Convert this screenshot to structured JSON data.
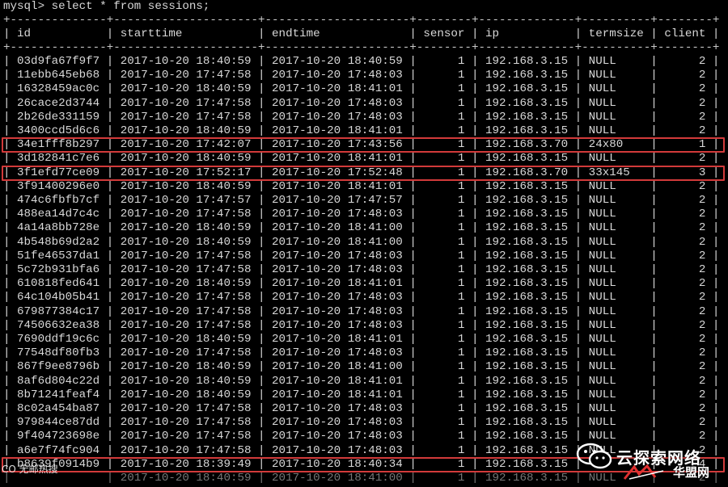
{
  "terminal": {
    "prompt": "mysql> ",
    "command": "select * from sessions;"
  },
  "table": {
    "border": "+--------------+---------------------+---------------------+--------+--------------+----------+--------+",
    "columns": [
      "id",
      "starttime",
      "endtime",
      "sensor",
      "ip",
      "termsize",
      "client"
    ],
    "rows": [
      [
        "03d9fa67f9f7",
        "2017-10-20 18:40:59",
        "2017-10-20 18:40:59",
        "1",
        "192.168.3.15",
        "NULL",
        "2"
      ],
      [
        "11ebb645eb68",
        "2017-10-20 17:47:58",
        "2017-10-20 17:48:03",
        "1",
        "192.168.3.15",
        "NULL",
        "2"
      ],
      [
        "16328459ac0c",
        "2017-10-20 18:40:59",
        "2017-10-20 18:41:01",
        "1",
        "192.168.3.15",
        "NULL",
        "2"
      ],
      [
        "26cace2d3744",
        "2017-10-20 17:47:58",
        "2017-10-20 17:48:03",
        "1",
        "192.168.3.15",
        "NULL",
        "2"
      ],
      [
        "2b26de331159",
        "2017-10-20 17:47:58",
        "2017-10-20 17:48:03",
        "1",
        "192.168.3.15",
        "NULL",
        "2"
      ],
      [
        "3400ccd5d6c6",
        "2017-10-20 18:40:59",
        "2017-10-20 18:41:01",
        "1",
        "192.168.3.15",
        "NULL",
        "2"
      ],
      [
        "34e1fff8b297",
        "2017-10-20 17:42:07",
        "2017-10-20 17:43:56",
        "1",
        "192.168.3.70",
        "24x80",
        "1"
      ],
      [
        "3d182841c7e6",
        "2017-10-20 18:40:59",
        "2017-10-20 18:41:01",
        "1",
        "192.168.3.15",
        "NULL",
        "2"
      ],
      [
        "3f1efd77ce09",
        "2017-10-20 17:52:17",
        "2017-10-20 17:52:48",
        "1",
        "192.168.3.70",
        "33x145",
        "3"
      ],
      [
        "3f91400296e0",
        "2017-10-20 18:40:59",
        "2017-10-20 18:41:01",
        "1",
        "192.168.3.15",
        "NULL",
        "2"
      ],
      [
        "474c6fbfb7cf",
        "2017-10-20 17:47:57",
        "2017-10-20 17:47:57",
        "1",
        "192.168.3.15",
        "NULL",
        "2"
      ],
      [
        "488ea14d7c4c",
        "2017-10-20 17:47:58",
        "2017-10-20 17:48:03",
        "1",
        "192.168.3.15",
        "NULL",
        "2"
      ],
      [
        "4a14a8bb728e",
        "2017-10-20 18:40:59",
        "2017-10-20 18:41:00",
        "1",
        "192.168.3.15",
        "NULL",
        "2"
      ],
      [
        "4b548b69d2a2",
        "2017-10-20 18:40:59",
        "2017-10-20 18:41:00",
        "1",
        "192.168.3.15",
        "NULL",
        "2"
      ],
      [
        "51fe46537da1",
        "2017-10-20 17:47:58",
        "2017-10-20 17:48:03",
        "1",
        "192.168.3.15",
        "NULL",
        "2"
      ],
      [
        "5c72b931bfa6",
        "2017-10-20 17:47:58",
        "2017-10-20 17:48:03",
        "1",
        "192.168.3.15",
        "NULL",
        "2"
      ],
      [
        "610818fed641",
        "2017-10-20 18:40:59",
        "2017-10-20 18:41:01",
        "1",
        "192.168.3.15",
        "NULL",
        "2"
      ],
      [
        "64c104b05b41",
        "2017-10-20 17:47:58",
        "2017-10-20 17:48:03",
        "1",
        "192.168.3.15",
        "NULL",
        "2"
      ],
      [
        "679877384c17",
        "2017-10-20 17:47:58",
        "2017-10-20 17:48:03",
        "1",
        "192.168.3.15",
        "NULL",
        "2"
      ],
      [
        "74506632ea38",
        "2017-10-20 17:47:58",
        "2017-10-20 17:48:03",
        "1",
        "192.168.3.15",
        "NULL",
        "2"
      ],
      [
        "7690ddf19c6c",
        "2017-10-20 18:40:59",
        "2017-10-20 18:41:01",
        "1",
        "192.168.3.15",
        "NULL",
        "2"
      ],
      [
        "77548df80fb3",
        "2017-10-20 17:47:58",
        "2017-10-20 17:48:03",
        "1",
        "192.168.3.15",
        "NULL",
        "2"
      ],
      [
        "867f9ee8796b",
        "2017-10-20 18:40:59",
        "2017-10-20 18:41:00",
        "1",
        "192.168.3.15",
        "NULL",
        "2"
      ],
      [
        "8af6d804c22d",
        "2017-10-20 18:40:59",
        "2017-10-20 18:41:01",
        "1",
        "192.168.3.15",
        "NULL",
        "2"
      ],
      [
        "8b71241feaf4",
        "2017-10-20 18:40:59",
        "2017-10-20 18:41:01",
        "1",
        "192.168.3.15",
        "NULL",
        "2"
      ],
      [
        "8c02a454ba87",
        "2017-10-20 17:47:58",
        "2017-10-20 17:48:03",
        "1",
        "192.168.3.15",
        "NULL",
        "2"
      ],
      [
        "979844ce87dd",
        "2017-10-20 17:47:58",
        "2017-10-20 17:48:03",
        "1",
        "192.168.3.15",
        "NULL",
        "2"
      ],
      [
        "9f404723698e",
        "2017-10-20 17:47:58",
        "2017-10-20 17:48:03",
        "1",
        "192.168.3.15",
        "NULL",
        "2"
      ],
      [
        "a6e7f74fc904",
        "2017-10-20 17:47:58",
        "2017-10-20 17:48:03",
        "1",
        "192.168.3.15",
        "NULL",
        "2"
      ],
      [
        "b8639f0914b9",
        "2017-10-20 18:39:49",
        "2017-10-20 18:40:34",
        "1",
        "192.168.3.15",
        "",
        "4"
      ],
      [
        "",
        "2017-10-20 18:40:59",
        "2017-10-20 18:41:00",
        "1",
        "192.168.3.15",
        "NULL",
        "2"
      ]
    ],
    "highlighted_rows": [
      6,
      8,
      29
    ],
    "highlight_color": "#d23a3a"
  },
  "watermark": {
    "left_text": "CO 无邮热搜",
    "brand": "云探索网络",
    "sub": "华盟网",
    "icon": "wechat-icon"
  }
}
